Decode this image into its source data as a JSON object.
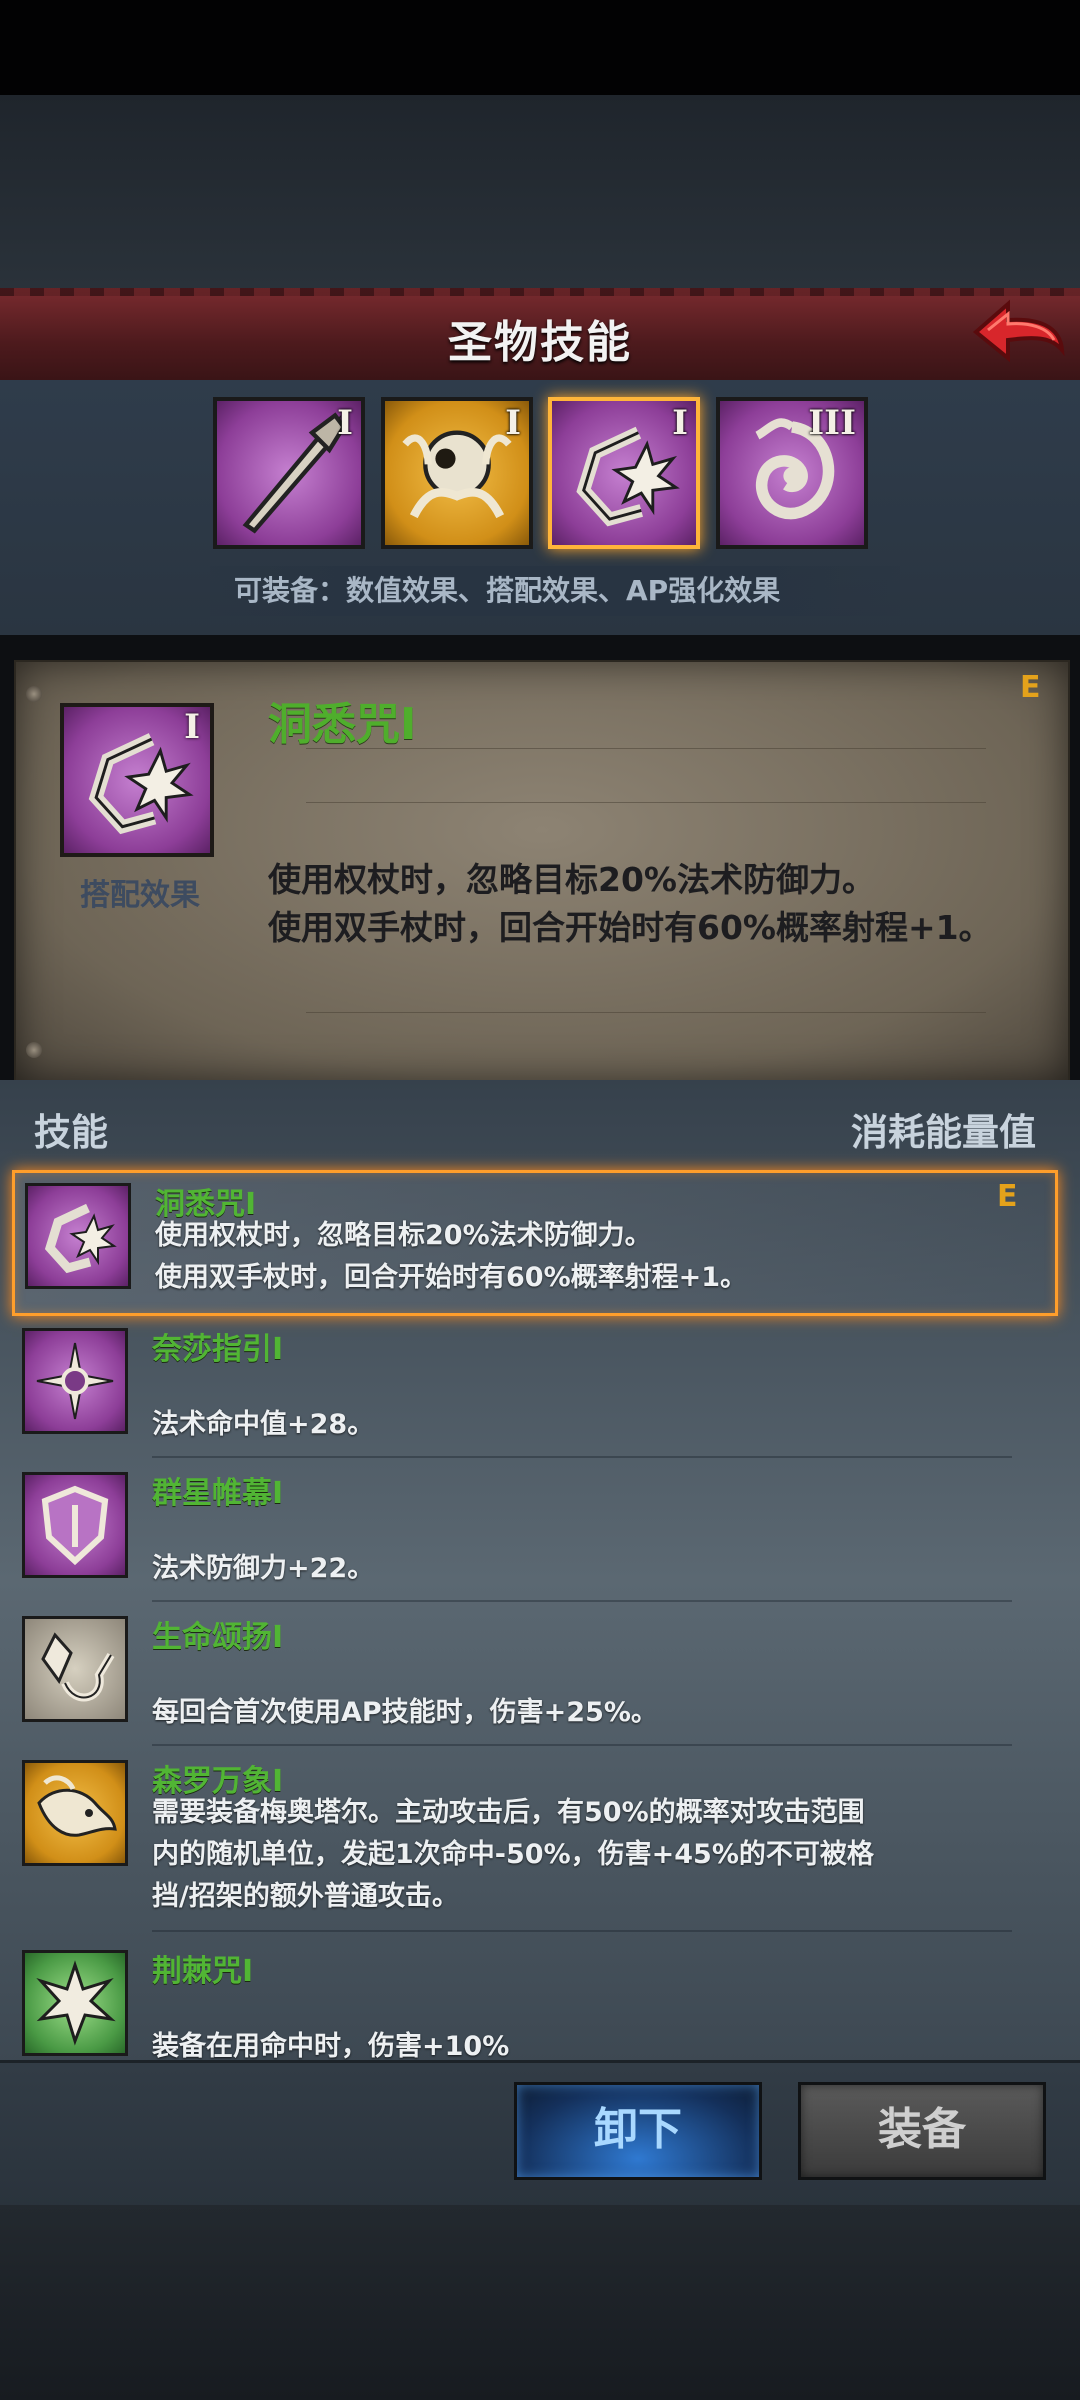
{
  "header": {
    "title": "圣物技能"
  },
  "relics": [
    {
      "roman": "I",
      "icon": "staff-icon",
      "style": "purple",
      "selected": false
    },
    {
      "roman": "I",
      "icon": "golden-orb-icon",
      "style": "gold",
      "selected": false
    },
    {
      "roman": "I",
      "icon": "burst-sigil-icon",
      "style": "purple",
      "selected": true
    },
    {
      "roman": "III",
      "icon": "swirl-rune-icon",
      "style": "purple",
      "selected": false
    }
  ],
  "equip_hint": "可装备：数值效果、搭配效果、AP强化效果",
  "detail": {
    "name": "洞悉咒I",
    "roman": "I",
    "grade": "E",
    "tag": "搭配效果",
    "lines": [
      "使用权杖时，忽略目标20%法术防御力。",
      "使用双手杖时，回合开始时有60%概率射程+1。"
    ]
  },
  "list_header": {
    "left": "技能",
    "right": "消耗能量值"
  },
  "skills": [
    {
      "name": "洞悉咒I",
      "grade": "E",
      "icon": "burst-sigil-icon",
      "desc": [
        "使用权杖时，忽略目标20%法术防御力。",
        "使用双手杖时，回合开始时有60%概率射程+1。"
      ]
    },
    {
      "name": "奈莎指引I",
      "icon": "cross-compass-icon",
      "desc": [
        "法术命中值+28。"
      ]
    },
    {
      "name": "群星帷幕I",
      "icon": "shield-icon",
      "desc": [
        "法术防御力+22。"
      ]
    },
    {
      "name": "生命颂扬I",
      "icon": "crystal-hook-icon",
      "desc": [
        "每回合首次使用AP技能时，伤害+25%。"
      ]
    },
    {
      "name": "森罗万象I",
      "icon": "golden-beast-icon",
      "desc": [
        "需要装备梅奥塔尔。主动攻击后，有50%的概率对攻击范围",
        "内的随机单位，发起1次命中-50%，伤害+45%的不可被格",
        "挡/招架的额外普通攻击。"
      ]
    },
    {
      "name": "荆棘咒I",
      "icon": "thorn-star-icon",
      "desc": [
        "装备在用命中时，伤害+10%"
      ]
    }
  ],
  "buttons": {
    "unequip": "卸下",
    "equip": "装备"
  }
}
